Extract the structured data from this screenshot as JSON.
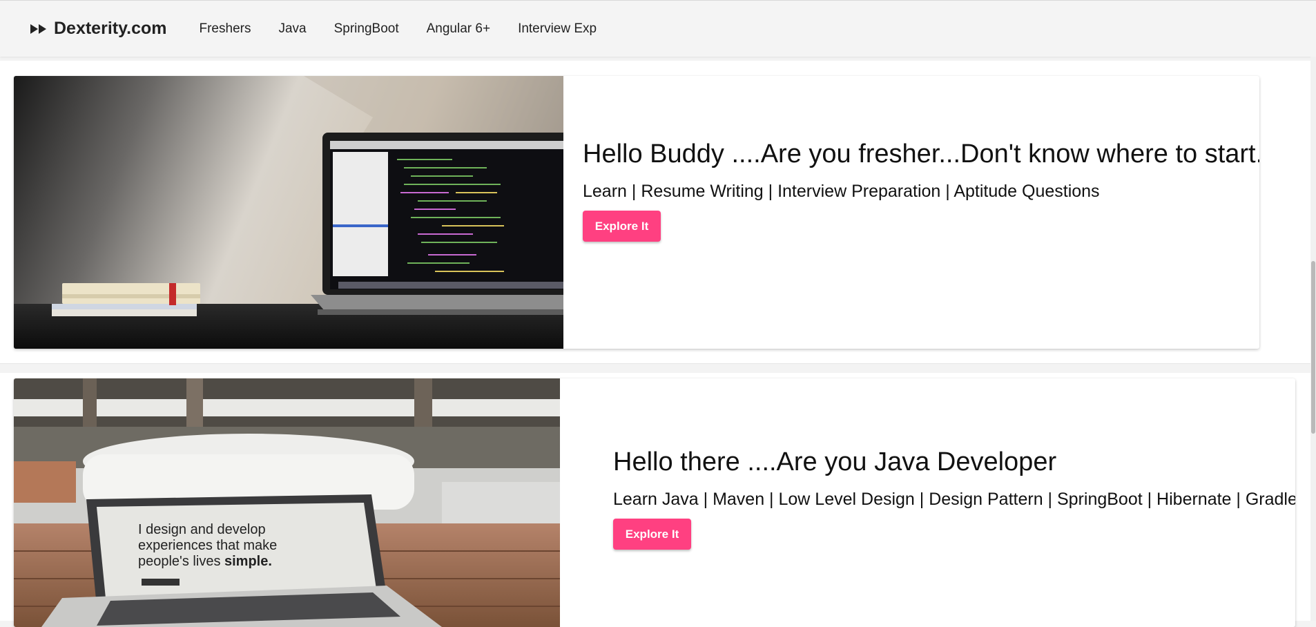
{
  "brand": {
    "name": "Dexterity.com",
    "icon": "fast-forward-icon"
  },
  "nav": {
    "items": [
      "Freshers",
      "Java",
      "SpringBoot",
      "Angular 6+",
      "Interview Exp"
    ]
  },
  "cards": [
    {
      "title": "Hello Buddy ....Are you fresher...Don't know where to start.",
      "subtitle": "Learn | Resume Writing | Interview Preparation | Aptitude Questions",
      "button": "Explore It",
      "image": "laptop-code-desk-photo"
    },
    {
      "title": "Hello there ....Are you Java Developer",
      "subtitle": "Learn Java | Maven | Low Level Design | Design Pattern | SpringBoot | Hibernate | Gradle",
      "button": "Explore It",
      "image": "laptop-cafe-photo",
      "image_text": "I design and develop experiences that make people's lives simple."
    }
  ],
  "colors": {
    "accent": "#ff4081",
    "navbar": "#f4f4f4",
    "page_bg": "#f3f3f3"
  }
}
